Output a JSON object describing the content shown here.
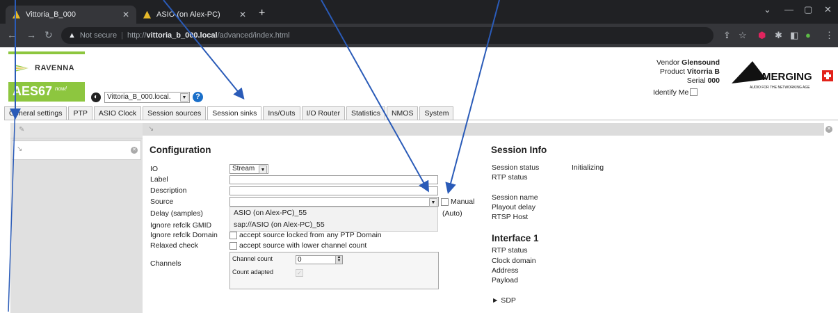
{
  "browser": {
    "tabs": [
      {
        "title": "Vittoria_B_000",
        "active": true
      },
      {
        "title": "ASIO (on Alex-PC)",
        "active": false
      }
    ],
    "url": {
      "security": "Not secure",
      "scheme": "http://",
      "host": "vittoria_b_000.local",
      "path": "/advanced/index.html"
    }
  },
  "header": {
    "ravenna_label": "RAVENNA",
    "aes_label": "AES67",
    "aes_now": "now!",
    "device_select": "Vittoria_B_000.local.",
    "help_label": "?",
    "vendor_label": "Vendor",
    "vendor_value": "Glensound",
    "product_label": "Product",
    "product_value": "Vitorria B",
    "serial_label": "Serial",
    "serial_value": "000",
    "identify_label": "Identify Me",
    "merging_brand": "MERGING",
    "merging_tagline": "AUDIO FOR THE NETWORKING AGE"
  },
  "nav": {
    "tabs": [
      "General settings",
      "PTP",
      "ASIO Clock",
      "Session sources",
      "Session sinks",
      "Ins/Outs",
      "I/O Router",
      "Statistics",
      "NMOS",
      "System"
    ],
    "active": "Session sinks"
  },
  "config": {
    "title": "Configuration",
    "io_label": "IO",
    "io_value": "Stream",
    "label_label": "Label",
    "description_label": "Description",
    "source_label": "Source",
    "manual_label": "Manual",
    "source_options": [
      "ASIO (on Alex-PC)_55",
      "sap://ASIO (on Alex-PC)_55"
    ],
    "delay_label": "Delay (samples)",
    "delay_auto": "(Auto)",
    "ignore_gmid_label": "Ignore refclk GMID",
    "ignore_domain_label": "Ignore refclk Domain",
    "ignore_domain_text": "accept source locked from any PTP Domain",
    "relaxed_label": "Relaxed check",
    "relaxed_text": "accept source with lower channel count",
    "channels_label": "Channels",
    "channel_count_label": "Channel count",
    "channel_count_value": "0",
    "count_adapted_label": "Count adapted"
  },
  "session_info": {
    "title": "Session Info",
    "session_status_label": "Session status",
    "session_status_value": "Initializing",
    "rtp_status_label": "RTP status",
    "session_name_label": "Session name",
    "playout_delay_label": "Playout delay",
    "rtsp_host_label": "RTSP Host",
    "interface_title": "Interface 1",
    "if_rtp_status_label": "RTP status",
    "clock_domain_label": "Clock domain",
    "address_label": "Address",
    "payload_label": "Payload",
    "sdp_label": "► SDP"
  },
  "colors": {
    "aes_green": "#8dc63f",
    "arrow_blue": "#2a5bb8",
    "merging_red": "#e2231a"
  }
}
